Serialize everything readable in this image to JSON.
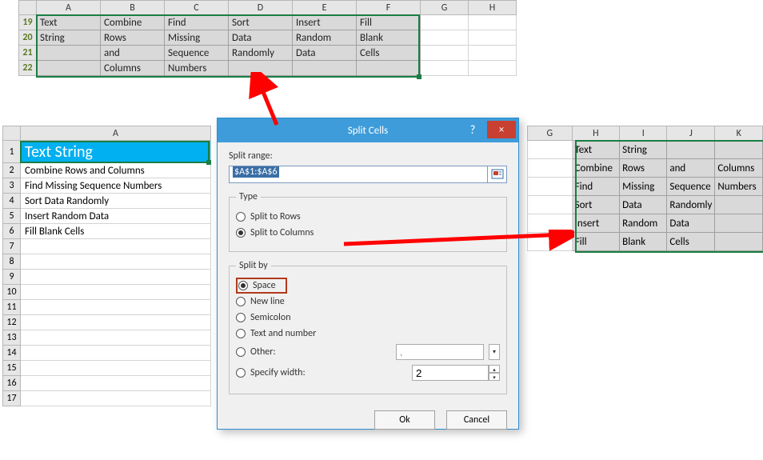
{
  "top": {
    "cols": [
      "A",
      "B",
      "C",
      "D",
      "E",
      "F",
      "G",
      "H"
    ],
    "rows": [
      "19",
      "20",
      "21",
      "22"
    ],
    "data": [
      [
        "Text",
        "Combine",
        "Find",
        "Sort",
        "Insert",
        "Fill"
      ],
      [
        "String",
        "Rows",
        "Missing",
        "Data",
        "Random",
        "Blank"
      ],
      [
        "",
        "and",
        "Sequence",
        "Randomly",
        "Data",
        "Cells"
      ],
      [
        "",
        "Columns",
        "Numbers",
        "",
        "",
        ""
      ]
    ]
  },
  "main": {
    "col": "A",
    "header": "Text String",
    "rows": [
      "1",
      "2",
      "3",
      "4",
      "5",
      "6",
      "7",
      "8",
      "9",
      "10",
      "11",
      "12",
      "13",
      "14",
      "15",
      "16",
      "17"
    ],
    "data": {
      "2": "Combine Rows and Columns",
      "3": "Find Missing Sequence Numbers",
      "4": "Sort Data Randomly",
      "5": "Insert Random Data",
      "6": "Fill Blank Cells"
    }
  },
  "right": {
    "cols": [
      "G",
      "H",
      "I",
      "J",
      "K"
    ],
    "data": [
      [
        "Text",
        "String",
        "",
        ""
      ],
      [
        "Combine",
        "Rows",
        "and",
        "Columns"
      ],
      [
        "Find",
        "Missing",
        "Sequence",
        "Numbers"
      ],
      [
        "Sort",
        "Data",
        "Randomly",
        ""
      ],
      [
        "Insert",
        "Random",
        "Data",
        ""
      ],
      [
        "Fill",
        "Blank",
        "Cells",
        ""
      ]
    ]
  },
  "dialog": {
    "title": "Split Cells",
    "help": "?",
    "close": "×",
    "range_label": "Split range:",
    "range_value": "$A$1:$A$6",
    "type_legend": "Type",
    "type_rows": "Split to Rows",
    "type_cols": "Split to Columns",
    "by_legend": "Split by",
    "by_space": "Space",
    "by_newline": "New line",
    "by_semicolon": "Semicolon",
    "by_textnum": "Text and number",
    "by_other": "Other:",
    "by_other_val": ",",
    "by_width": "Specify width:",
    "by_width_val": "2",
    "ok": "Ok",
    "cancel": "Cancel"
  }
}
